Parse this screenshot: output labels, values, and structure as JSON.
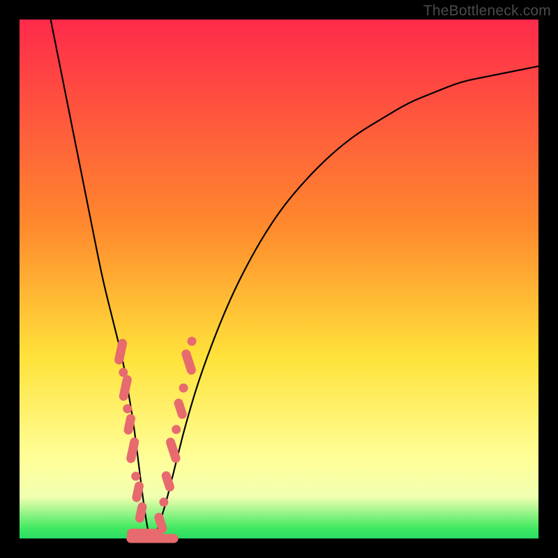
{
  "watermark": "TheBottleneck.com",
  "colors": {
    "top": "#ff2a4b",
    "orange": "#ff8a2d",
    "yellow": "#ffe23a",
    "pale": "#ffff9a",
    "pale2": "#f1ffb0",
    "green": "#41e961",
    "green2": "#2bdc64",
    "marker": "#e76a6e"
  },
  "chart_data": {
    "type": "line",
    "title": "",
    "xlabel": "",
    "ylabel": "",
    "xlim": [
      0,
      100
    ],
    "ylim": [
      0,
      100
    ],
    "legend": false,
    "grid": false,
    "series": [
      {
        "name": "bottleneck-curve",
        "x": [
          6,
          8,
          10,
          12,
          14,
          16,
          18,
          20,
          21,
          22,
          23,
          24,
          25,
          26,
          28,
          30,
          32,
          35,
          40,
          45,
          50,
          55,
          60,
          65,
          70,
          75,
          80,
          85,
          90,
          95,
          100
        ],
        "y": [
          100,
          90,
          80,
          70,
          60,
          50,
          42,
          34,
          28,
          22,
          14,
          6,
          0,
          0,
          6,
          14,
          22,
          32,
          45,
          55,
          63,
          69,
          74,
          78,
          81,
          84,
          86,
          88,
          89,
          90,
          91
        ]
      }
    ],
    "markers": {
      "name": "highlight-points",
      "note": "salmon dots/capsules clustered on both sides of the V near the bottom",
      "points": [
        {
          "x": 19.5,
          "y": 36,
          "shape": "capsule",
          "len": 5
        },
        {
          "x": 20.0,
          "y": 32,
          "shape": "dot"
        },
        {
          "x": 20.4,
          "y": 29,
          "shape": "capsule",
          "len": 5
        },
        {
          "x": 20.8,
          "y": 25,
          "shape": "dot"
        },
        {
          "x": 21.2,
          "y": 22,
          "shape": "capsule",
          "len": 4
        },
        {
          "x": 21.8,
          "y": 17,
          "shape": "capsule",
          "len": 5
        },
        {
          "x": 22.4,
          "y": 12,
          "shape": "dot"
        },
        {
          "x": 22.8,
          "y": 9,
          "shape": "capsule",
          "len": 4
        },
        {
          "x": 23.4,
          "y": 5,
          "shape": "capsule",
          "len": 4
        },
        {
          "x": 24.2,
          "y": 1,
          "shape": "capsule",
          "len": 7,
          "horiz": true
        },
        {
          "x": 25.6,
          "y": 0,
          "shape": "capsule",
          "len": 10,
          "horiz": true
        },
        {
          "x": 27.2,
          "y": 3,
          "shape": "capsule",
          "len": 4
        },
        {
          "x": 27.8,
          "y": 7,
          "shape": "dot"
        },
        {
          "x": 28.6,
          "y": 11,
          "shape": "capsule",
          "len": 4
        },
        {
          "x": 29.6,
          "y": 17,
          "shape": "capsule",
          "len": 5
        },
        {
          "x": 30.2,
          "y": 21,
          "shape": "dot"
        },
        {
          "x": 31.0,
          "y": 25,
          "shape": "capsule",
          "len": 4
        },
        {
          "x": 31.6,
          "y": 29,
          "shape": "dot"
        },
        {
          "x": 32.6,
          "y": 34,
          "shape": "capsule",
          "len": 5
        },
        {
          "x": 33.2,
          "y": 38,
          "shape": "dot"
        }
      ]
    }
  }
}
